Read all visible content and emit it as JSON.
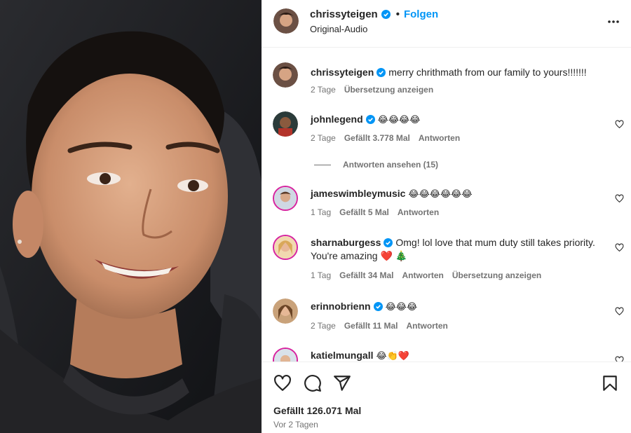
{
  "post": {
    "username": "chrissyteigen",
    "follow_label": "Folgen",
    "separator": "•",
    "audio": "Original-Audio",
    "more_icon": "more-horizontal-icon"
  },
  "caption": {
    "username": "chrissyteigen",
    "text": "merry chrithmath from our family to yours!!!!!!!",
    "time": "2 Tage",
    "translate": "Übersetzung anzeigen"
  },
  "comments": [
    {
      "username": "johnlegend",
      "verified": true,
      "text": "😂😂😂😂",
      "time": "2 Tage",
      "likes": "Gefällt 3.778 Mal",
      "reply": "Antworten",
      "view_replies": "Antworten ansehen (15)"
    },
    {
      "username": "jameswimbleymusic",
      "verified": false,
      "text": "😂😂😂😂😂😂",
      "time": "1 Tag",
      "likes": "Gefällt 5 Mal",
      "reply": "Antworten"
    },
    {
      "username": "sharnaburgess",
      "verified": true,
      "text": "Omg! lol love that mum duty still takes priority. You're amazing ❤️ 🎄",
      "time": "1 Tag",
      "likes": "Gefällt 34 Mal",
      "reply": "Antworten",
      "translate": "Übersetzung anzeigen"
    },
    {
      "username": "erinnobrienn",
      "verified": true,
      "text": "😂😂😂",
      "time": "2 Tage",
      "likes": "Gefällt 11 Mal",
      "reply": "Antworten"
    },
    {
      "username": "katielmungall",
      "verified": false,
      "text": "😂👏❤️"
    }
  ],
  "footer": {
    "likes": "Gefällt 126.071 Mal",
    "date": "Vor 2 Tagen"
  },
  "colors": {
    "accent": "#0095f6",
    "verified": "#0095f6",
    "muted": "#737373",
    "text": "#262626"
  }
}
